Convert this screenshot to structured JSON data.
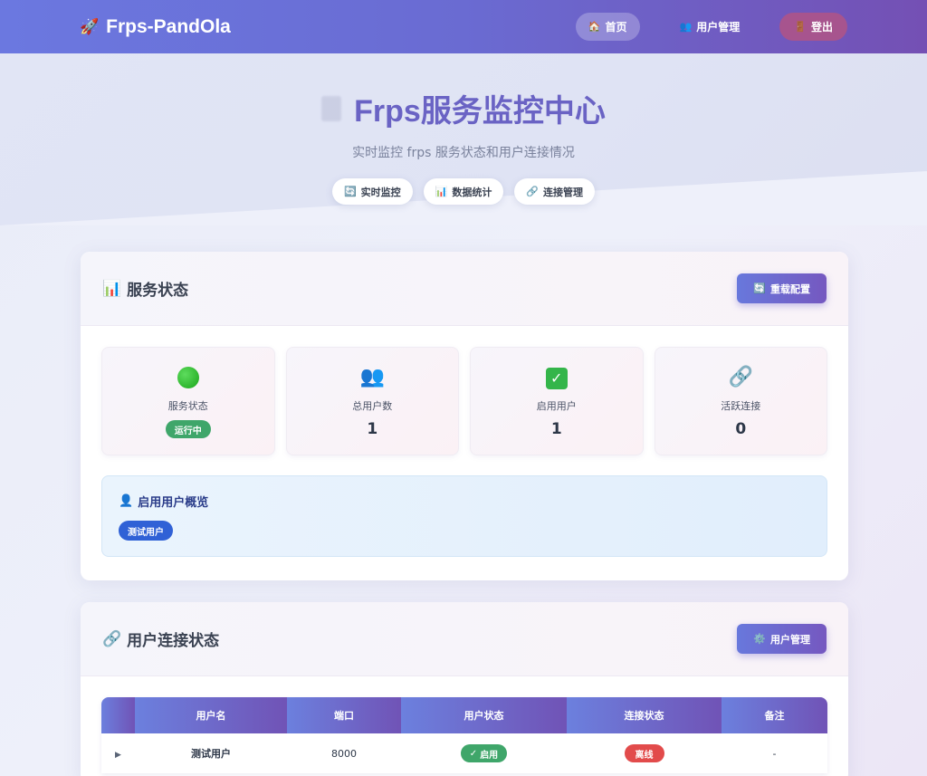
{
  "navbar": {
    "brand": "Frps-PandOla",
    "brand_icon": "rocket-icon",
    "items": [
      {
        "label": "首页",
        "icon": "🏠"
      },
      {
        "label": "用户管理",
        "icon": "👥"
      },
      {
        "label": "登出",
        "icon": "🚪"
      }
    ]
  },
  "hero": {
    "title": "Frps服务监控中心",
    "subtitle": "实时监控 frps 服务状态和用户连接情况",
    "pills": [
      {
        "label": "实时监控",
        "icon": "🔄"
      },
      {
        "label": "数据统计",
        "icon": "📊"
      },
      {
        "label": "连接管理",
        "icon": "🔗"
      }
    ]
  },
  "service_status": {
    "title": "服务状态",
    "title_icon": "📊",
    "reload_button": "重载配置",
    "reload_icon": "🔄",
    "stats": [
      {
        "label": "服务状态",
        "icon": "green-circle-icon",
        "badge": "运行中"
      },
      {
        "label": "总用户数",
        "icon": "👥",
        "value": "1"
      },
      {
        "label": "启用用户",
        "icon": "check-mark-icon",
        "value": "1"
      },
      {
        "label": "活跃连接",
        "icon": "🔗",
        "value": "0"
      }
    ],
    "overview": {
      "title": "启用用户概览",
      "icon": "👤",
      "users": [
        "测试用户"
      ]
    }
  },
  "connections": {
    "title": "用户连接状态",
    "title_icon": "🔗",
    "manage_button": "用户管理",
    "manage_icon": "⚙️",
    "columns": [
      "",
      "用户名",
      "端口",
      "用户状态",
      "连接状态",
      "备注"
    ],
    "rows": [
      {
        "username": "测试用户",
        "port": "8000",
        "user_status": "启用",
        "conn_status": "离线",
        "note": "-"
      }
    ]
  },
  "colors": {
    "accent": "#6a6bd2",
    "running": "#3fa66a",
    "offline": "#e24b4b",
    "chip": "#3061d6"
  }
}
